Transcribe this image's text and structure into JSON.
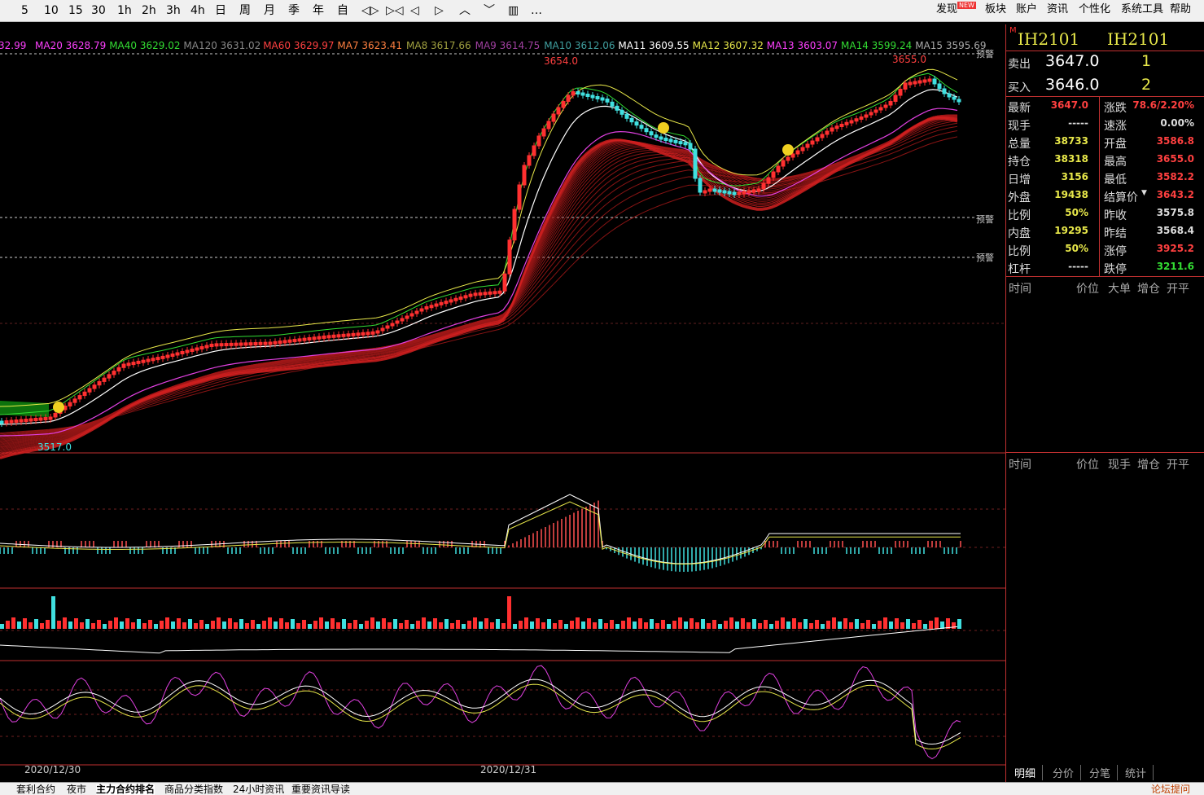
{
  "toolbar": {
    "left_items": [
      "5",
      "10",
      "15",
      "30",
      "1h",
      "2h",
      "3h",
      "4h",
      "日",
      "周",
      "月",
      "季",
      "年",
      "自"
    ],
    "icon_items": [
      "prev-bar-icon",
      "next-bar-icon",
      "scroll-left-icon",
      "scroll-right-icon",
      "zoom-in-icon",
      "zoom-out-icon",
      "layout-icon",
      "more-icon"
    ],
    "more_label": "…",
    "menus": [
      "发现",
      "板块",
      "账户",
      "资讯",
      "个性化",
      "系统工具",
      "帮助"
    ],
    "new_badge": "NEW"
  },
  "ma_legend": [
    {
      "label": "32.99",
      "color": "#ff40ff"
    },
    {
      "label": "MA20 3628.79",
      "color": "#ff40ff"
    },
    {
      "label": "MA40 3629.02",
      "color": "#33dd33"
    },
    {
      "label": "MA120 3631.02",
      "color": "#888888"
    },
    {
      "label": "MA60 3629.97",
      "color": "#ff4040"
    },
    {
      "label": "MA7 3623.41",
      "color": "#ff8040"
    },
    {
      "label": "MA8 3617.66",
      "color": "#a0a040"
    },
    {
      "label": "MA9 3614.75",
      "color": "#a040a0"
    },
    {
      "label": "MA10 3612.06",
      "color": "#40a0a0"
    },
    {
      "label": "MA11 3609.55",
      "color": "#ffffff"
    },
    {
      "label": "MA12 3607.32",
      "color": "#e8e84a"
    },
    {
      "label": "MA13 3603.07",
      "color": "#ff40ff"
    },
    {
      "label": "MA14 3599.24",
      "color": "#33dd33"
    },
    {
      "label": "MA15 3595.69",
      "color": "#aaaaaa"
    }
  ],
  "price_labels": {
    "high_left": "3654.0",
    "high_right": "3655.0",
    "low": "3517.0"
  },
  "alert_label": "预警",
  "x_dates": [
    "2020/12/30",
    "2020/12/31"
  ],
  "quote": {
    "code1": "IH2101",
    "code2": "IH2101",
    "ask_label": "卖出",
    "ask_price": "3647.0",
    "ask_vol": "1",
    "bid_label": "买入",
    "bid_price": "3646.0",
    "bid_vol": "2",
    "rows": [
      {
        "l1": "最新",
        "v1": "3647.0",
        "c1": "r",
        "l2": "涨跌",
        "v2": "78.6/2.20%",
        "c2": "r"
      },
      {
        "l1": "现手",
        "v1": "-----",
        "c1": "w",
        "l2": "速涨",
        "v2": "0.00%",
        "c2": "w"
      },
      {
        "l1": "总量",
        "v1": "38733",
        "c1": "y",
        "l2": "开盘",
        "v2": "3586.8",
        "c2": "r"
      },
      {
        "l1": "持仓",
        "v1": "38318",
        "c1": "y",
        "l2": "最高",
        "v2": "3655.0",
        "c2": "r"
      },
      {
        "l1": "日增",
        "v1": "3156",
        "c1": "y",
        "l2": "最低",
        "v2": "3582.2",
        "c2": "r"
      },
      {
        "l1": "外盘",
        "v1": "19438",
        "c1": "y",
        "l2": "结算价",
        "v2": "3643.2",
        "c2": "r"
      },
      {
        "l1": "比例",
        "v1": "50%",
        "c1": "y",
        "l2": "昨收",
        "v2": "3575.8",
        "c2": "w"
      },
      {
        "l1": "内盘",
        "v1": "19295",
        "c1": "y",
        "l2": "昨结",
        "v2": "3568.4",
        "c2": "w"
      },
      {
        "l1": "比例",
        "v1": "50%",
        "c1": "y",
        "l2": "涨停",
        "v2": "3925.2",
        "c2": "r"
      },
      {
        "l1": "杠杆",
        "v1": "-----",
        "c1": "w",
        "l2": "跌停",
        "v2": "3211.6",
        "c2": "g"
      }
    ],
    "table1_headers": [
      "时间",
      "价位",
      "大单",
      "增仓",
      "开平"
    ],
    "table2_headers": [
      "时间",
      "价位",
      "现手",
      "增仓",
      "开平"
    ],
    "bottom_tabs": [
      "明细",
      "分价",
      "分笔",
      "统计"
    ]
  },
  "statusbar": {
    "tabs": [
      "套利合约",
      "夜市",
      "主力合约排名",
      "商品分类指数",
      "24小时资讯",
      "重要资讯导读"
    ],
    "right_link": "论坛提问"
  },
  "colors": {
    "up": "#ff3030",
    "down": "#40e0e0",
    "accent": "#c03030",
    "yellow": "#e8e84a"
  }
}
